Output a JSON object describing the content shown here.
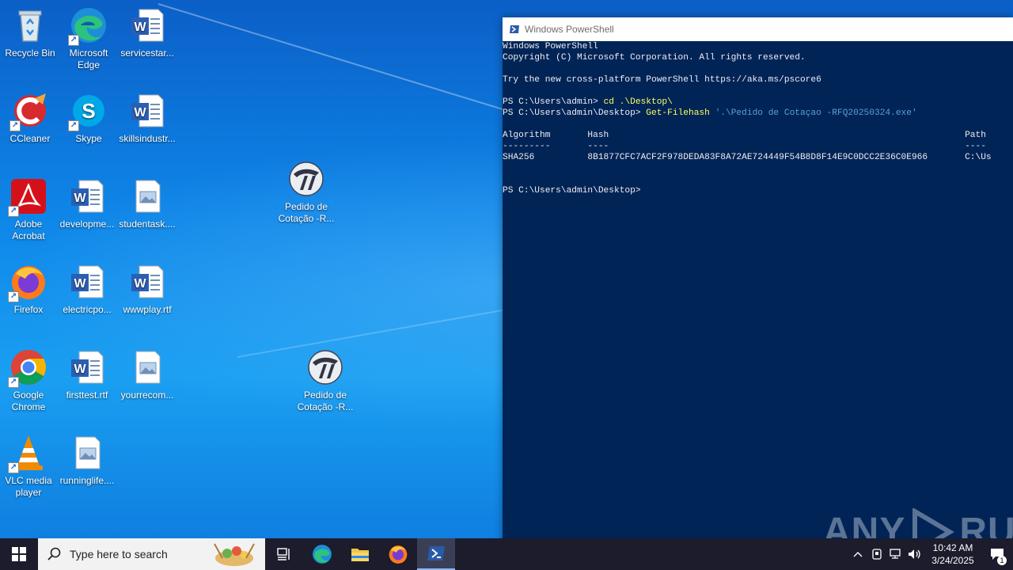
{
  "desktop": {
    "icons": [
      {
        "label": "Recycle Bin",
        "icon": "recycle-bin-icon",
        "shortcut": false
      },
      {
        "label": "Microsoft Edge",
        "icon": "edge-icon",
        "shortcut": true
      },
      {
        "label": "servicestar...",
        "icon": "word-doc-icon",
        "shortcut": false
      },
      {
        "label": "CCleaner",
        "icon": "ccleaner-icon",
        "shortcut": true
      },
      {
        "label": "Skype",
        "icon": "skype-icon",
        "shortcut": true
      },
      {
        "label": "skillsindustr...",
        "icon": "word-doc-icon",
        "shortcut": false
      },
      {
        "label": "Adobe Acrobat",
        "icon": "acrobat-icon",
        "shortcut": true
      },
      {
        "label": "developme...",
        "icon": "word-doc-icon",
        "shortcut": false
      },
      {
        "label": "studentask....",
        "icon": "image-file-icon",
        "shortcut": false
      },
      {
        "label": "Firefox",
        "icon": "firefox-icon",
        "shortcut": true
      },
      {
        "label": "electricpo...",
        "icon": "word-doc-icon",
        "shortcut": false
      },
      {
        "label": "wwwplay.rtf",
        "icon": "word-doc-icon",
        "shortcut": false
      },
      {
        "label": "Google Chrome",
        "icon": "chrome-icon",
        "shortcut": true
      },
      {
        "label": "firsttest.rtf",
        "icon": "word-doc-icon",
        "shortcut": false
      },
      {
        "label": "yourrecom...",
        "icon": "image-file-icon",
        "shortcut": false
      },
      {
        "label": "VLC media player",
        "icon": "vlc-icon",
        "shortcut": true
      },
      {
        "label": "runninglife....",
        "icon": "image-file-icon",
        "shortcut": false
      },
      {
        "label": "Pedido de Cotação -R...",
        "icon": "exe-logo-icon",
        "shortcut": false
      },
      {
        "label": "Pedido de Cotação -R...",
        "icon": "exe-logo-icon",
        "shortcut": false
      }
    ]
  },
  "powershell": {
    "title": "Windows PowerShell",
    "lines": {
      "l1": "Windows PowerShell",
      "l2": "Copyright (C) Microsoft Corporation. All rights reserved.",
      "l3": "Try the new cross-platform PowerShell https://aka.ms/pscore6",
      "prompt1": "PS C:\\Users\\admin> ",
      "cmd1": "cd .\\Desktop\\",
      "prompt2": "PS C:\\Users\\admin\\Desktop> ",
      "cmd2": "Get-Filehash",
      "arg2": " '.\\Pedido de Cotaçao -RFQ20250324.exe'",
      "header": "Algorithm       Hash                                                                   Path",
      "divider": "---------       ----                                                                   ----",
      "row": "SHA256          8B1877CFC7ACF2F978DEDA83F8A72AE724449F54B8D8F14E9C0DCC2E36C0E966       C:\\Us",
      "prompt3": "PS C:\\Users\\admin\\Desktop> "
    },
    "watermark": {
      "left": "ANY",
      "right": "RUN"
    }
  },
  "taskbar": {
    "search_placeholder": "Type here to search",
    "pinned": [
      "task-view-icon",
      "edge-icon",
      "file-explorer-icon",
      "firefox-icon",
      "powershell-icon"
    ],
    "clock": {
      "time": "10:42 AM",
      "date": "3/24/2025"
    },
    "notification_count": "1"
  },
  "colors": {
    "ps_background": "#012456",
    "taskbar": "#1c1c2c",
    "ps_command": "#ffff60"
  }
}
